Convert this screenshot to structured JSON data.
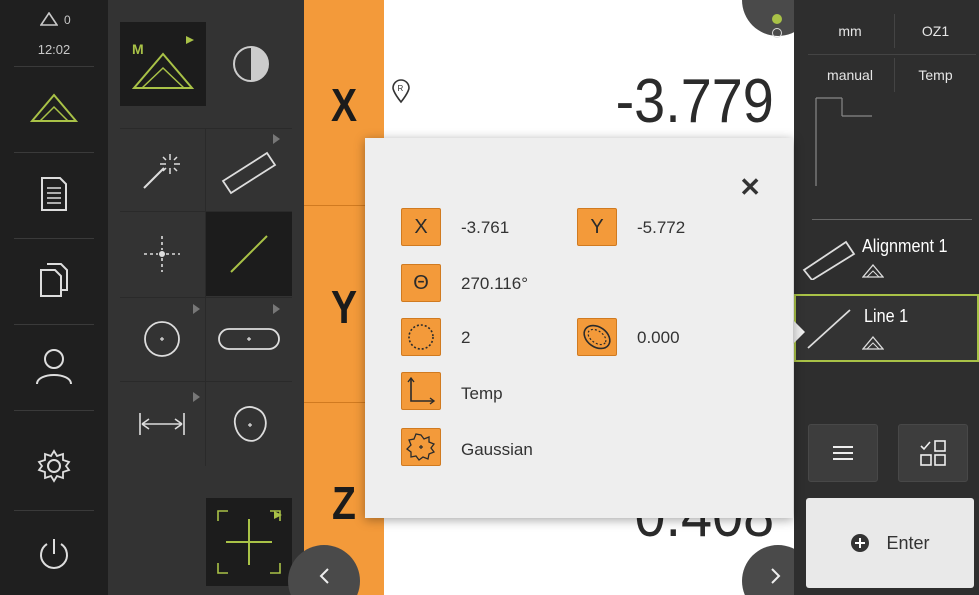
{
  "status": {
    "message_count": "0",
    "time": "12:02"
  },
  "axes": {
    "x_label": "X",
    "y_label": "Y",
    "z_label": "Z"
  },
  "readout": {
    "x_value": "-3.779",
    "z_value_partial": "0.408"
  },
  "right_panel": {
    "unit": "mm",
    "preset": "OZ1",
    "mode": "manual",
    "temp": "Temp",
    "elements": [
      {
        "label": "Alignment 1"
      },
      {
        "label": "Line 1"
      }
    ],
    "enter_label": "Enter"
  },
  "dialog": {
    "x_icon": "X",
    "x_value": "-3.761",
    "y_icon": "Y",
    "y_value": "-5.772",
    "angle_icon": "Θ",
    "angle_value": "270.116°",
    "points_value": "2",
    "form_error_value": "0.000",
    "coord_system_value": "Temp",
    "filter_value": "Gaussian",
    "close_label": "✕"
  },
  "colors": {
    "accent_green": "#a9c247",
    "axis_orange": "#f39a3a",
    "active_dot": "#a9c247"
  }
}
